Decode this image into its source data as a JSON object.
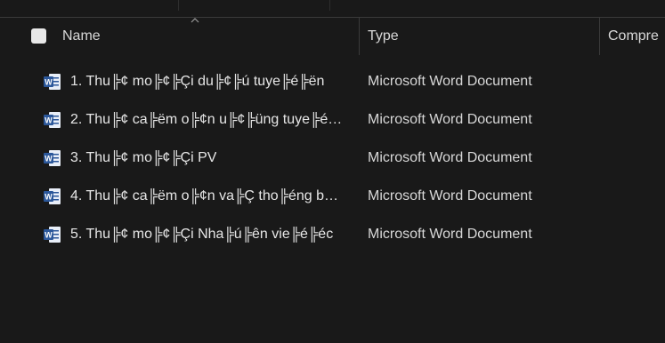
{
  "columns": {
    "name": "Name",
    "type": "Type",
    "compressed": "Compre"
  },
  "files": [
    {
      "name": "1. Thu╠¢ mo╠¢╠Çi du╠¢╠ú tuye╠é╠ën",
      "type": "Microsoft Word Document",
      "icon": "word-document-icon"
    },
    {
      "name": "2. Thu╠¢ ca╠ëm o╠¢n u╠¢╠üng tuye╠é…",
      "type": "Microsoft Word Document",
      "icon": "word-document-icon"
    },
    {
      "name": "3. Thu╠¢ mo╠¢╠Çi PV",
      "type": "Microsoft Word Document",
      "icon": "word-document-icon"
    },
    {
      "name": "4. Thu╠¢ ca╠ëm o╠¢n va╠Ç tho╠éng b…",
      "type": "Microsoft Word Document",
      "icon": "word-document-icon"
    },
    {
      "name": "5. Thu╠¢ mo╠¢╠Çi Nha╠ú╠ên vie╠é╠éc",
      "type": "Microsoft Word Document",
      "icon": "word-document-icon"
    }
  ],
  "colors": {
    "background": "#191919",
    "text": "#e6e6e6",
    "divider": "#3a3a3a",
    "word_blue": "#2b579a"
  }
}
